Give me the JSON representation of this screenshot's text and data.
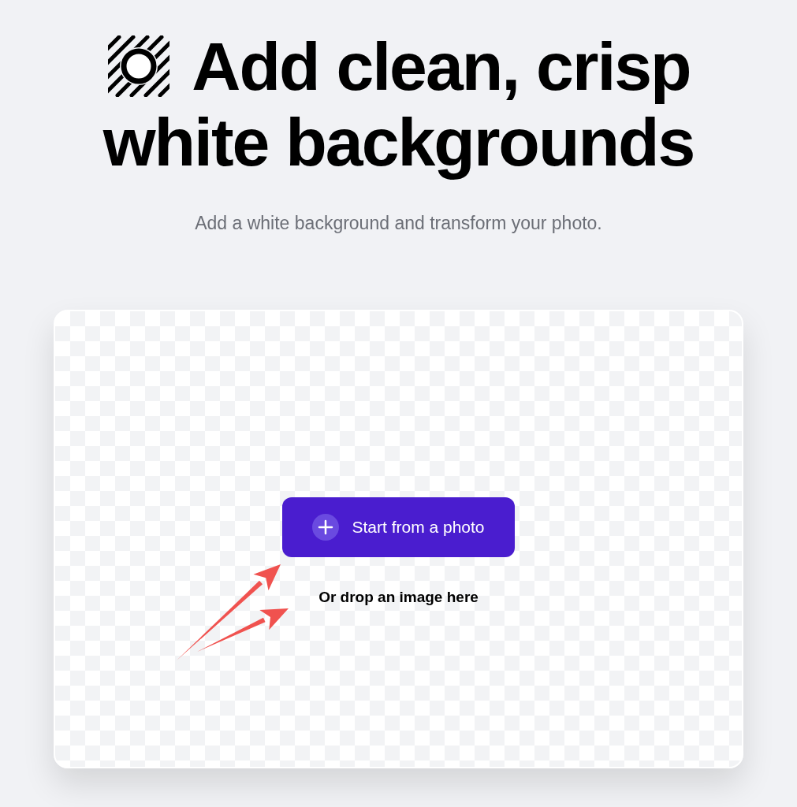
{
  "headline_lines": [
    "Add clean, crisp",
    "white backgrounds"
  ],
  "subtitle": "Add a white background and transform your photo.",
  "upload_card": {
    "button": {
      "label": "Start from a photo"
    },
    "drop_hint": "Or drop an image here"
  }
}
